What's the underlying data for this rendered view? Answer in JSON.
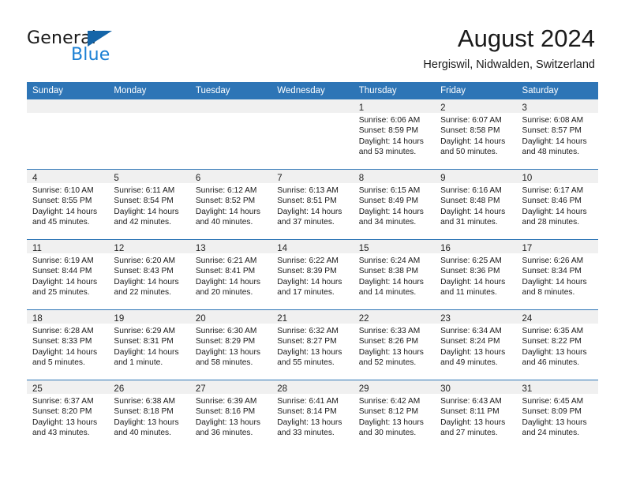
{
  "brand": {
    "name_part1": "General",
    "name_part2": "Blue",
    "triangle_icon": "blue-triangle-icon"
  },
  "header": {
    "title": "August 2024",
    "subtitle": "Hergiswil, Nidwalden, Switzerland"
  },
  "colors": {
    "header_blue": "#2e75b6",
    "daynum_band": "#f0f0f0",
    "logo_blue": "#1a7fd4",
    "logo_triangle": "#1565a8",
    "text": "#1a1a1a"
  },
  "calendar": {
    "weekday_headers": [
      "Sunday",
      "Monday",
      "Tuesday",
      "Wednesday",
      "Thursday",
      "Friday",
      "Saturday"
    ],
    "weeks": [
      [
        {
          "empty": true
        },
        {
          "empty": true
        },
        {
          "empty": true
        },
        {
          "empty": true
        },
        {
          "day": "1",
          "sunrise": "Sunrise: 6:06 AM",
          "sunset": "Sunset: 8:59 PM",
          "daylight1": "Daylight: 14 hours",
          "daylight2": "and 53 minutes."
        },
        {
          "day": "2",
          "sunrise": "Sunrise: 6:07 AM",
          "sunset": "Sunset: 8:58 PM",
          "daylight1": "Daylight: 14 hours",
          "daylight2": "and 50 minutes."
        },
        {
          "day": "3",
          "sunrise": "Sunrise: 6:08 AM",
          "sunset": "Sunset: 8:57 PM",
          "daylight1": "Daylight: 14 hours",
          "daylight2": "and 48 minutes."
        }
      ],
      [
        {
          "day": "4",
          "sunrise": "Sunrise: 6:10 AM",
          "sunset": "Sunset: 8:55 PM",
          "daylight1": "Daylight: 14 hours",
          "daylight2": "and 45 minutes."
        },
        {
          "day": "5",
          "sunrise": "Sunrise: 6:11 AM",
          "sunset": "Sunset: 8:54 PM",
          "daylight1": "Daylight: 14 hours",
          "daylight2": "and 42 minutes."
        },
        {
          "day": "6",
          "sunrise": "Sunrise: 6:12 AM",
          "sunset": "Sunset: 8:52 PM",
          "daylight1": "Daylight: 14 hours",
          "daylight2": "and 40 minutes."
        },
        {
          "day": "7",
          "sunrise": "Sunrise: 6:13 AM",
          "sunset": "Sunset: 8:51 PM",
          "daylight1": "Daylight: 14 hours",
          "daylight2": "and 37 minutes."
        },
        {
          "day": "8",
          "sunrise": "Sunrise: 6:15 AM",
          "sunset": "Sunset: 8:49 PM",
          "daylight1": "Daylight: 14 hours",
          "daylight2": "and 34 minutes."
        },
        {
          "day": "9",
          "sunrise": "Sunrise: 6:16 AM",
          "sunset": "Sunset: 8:48 PM",
          "daylight1": "Daylight: 14 hours",
          "daylight2": "and 31 minutes."
        },
        {
          "day": "10",
          "sunrise": "Sunrise: 6:17 AM",
          "sunset": "Sunset: 8:46 PM",
          "daylight1": "Daylight: 14 hours",
          "daylight2": "and 28 minutes."
        }
      ],
      [
        {
          "day": "11",
          "sunrise": "Sunrise: 6:19 AM",
          "sunset": "Sunset: 8:44 PM",
          "daylight1": "Daylight: 14 hours",
          "daylight2": "and 25 minutes."
        },
        {
          "day": "12",
          "sunrise": "Sunrise: 6:20 AM",
          "sunset": "Sunset: 8:43 PM",
          "daylight1": "Daylight: 14 hours",
          "daylight2": "and 22 minutes."
        },
        {
          "day": "13",
          "sunrise": "Sunrise: 6:21 AM",
          "sunset": "Sunset: 8:41 PM",
          "daylight1": "Daylight: 14 hours",
          "daylight2": "and 20 minutes."
        },
        {
          "day": "14",
          "sunrise": "Sunrise: 6:22 AM",
          "sunset": "Sunset: 8:39 PM",
          "daylight1": "Daylight: 14 hours",
          "daylight2": "and 17 minutes."
        },
        {
          "day": "15",
          "sunrise": "Sunrise: 6:24 AM",
          "sunset": "Sunset: 8:38 PM",
          "daylight1": "Daylight: 14 hours",
          "daylight2": "and 14 minutes."
        },
        {
          "day": "16",
          "sunrise": "Sunrise: 6:25 AM",
          "sunset": "Sunset: 8:36 PM",
          "daylight1": "Daylight: 14 hours",
          "daylight2": "and 11 minutes."
        },
        {
          "day": "17",
          "sunrise": "Sunrise: 6:26 AM",
          "sunset": "Sunset: 8:34 PM",
          "daylight1": "Daylight: 14 hours",
          "daylight2": "and 8 minutes."
        }
      ],
      [
        {
          "day": "18",
          "sunrise": "Sunrise: 6:28 AM",
          "sunset": "Sunset: 8:33 PM",
          "daylight1": "Daylight: 14 hours",
          "daylight2": "and 5 minutes."
        },
        {
          "day": "19",
          "sunrise": "Sunrise: 6:29 AM",
          "sunset": "Sunset: 8:31 PM",
          "daylight1": "Daylight: 14 hours",
          "daylight2": "and 1 minute."
        },
        {
          "day": "20",
          "sunrise": "Sunrise: 6:30 AM",
          "sunset": "Sunset: 8:29 PM",
          "daylight1": "Daylight: 13 hours",
          "daylight2": "and 58 minutes."
        },
        {
          "day": "21",
          "sunrise": "Sunrise: 6:32 AM",
          "sunset": "Sunset: 8:27 PM",
          "daylight1": "Daylight: 13 hours",
          "daylight2": "and 55 minutes."
        },
        {
          "day": "22",
          "sunrise": "Sunrise: 6:33 AM",
          "sunset": "Sunset: 8:26 PM",
          "daylight1": "Daylight: 13 hours",
          "daylight2": "and 52 minutes."
        },
        {
          "day": "23",
          "sunrise": "Sunrise: 6:34 AM",
          "sunset": "Sunset: 8:24 PM",
          "daylight1": "Daylight: 13 hours",
          "daylight2": "and 49 minutes."
        },
        {
          "day": "24",
          "sunrise": "Sunrise: 6:35 AM",
          "sunset": "Sunset: 8:22 PM",
          "daylight1": "Daylight: 13 hours",
          "daylight2": "and 46 minutes."
        }
      ],
      [
        {
          "day": "25",
          "sunrise": "Sunrise: 6:37 AM",
          "sunset": "Sunset: 8:20 PM",
          "daylight1": "Daylight: 13 hours",
          "daylight2": "and 43 minutes."
        },
        {
          "day": "26",
          "sunrise": "Sunrise: 6:38 AM",
          "sunset": "Sunset: 8:18 PM",
          "daylight1": "Daylight: 13 hours",
          "daylight2": "and 40 minutes."
        },
        {
          "day": "27",
          "sunrise": "Sunrise: 6:39 AM",
          "sunset": "Sunset: 8:16 PM",
          "daylight1": "Daylight: 13 hours",
          "daylight2": "and 36 minutes."
        },
        {
          "day": "28",
          "sunrise": "Sunrise: 6:41 AM",
          "sunset": "Sunset: 8:14 PM",
          "daylight1": "Daylight: 13 hours",
          "daylight2": "and 33 minutes."
        },
        {
          "day": "29",
          "sunrise": "Sunrise: 6:42 AM",
          "sunset": "Sunset: 8:12 PM",
          "daylight1": "Daylight: 13 hours",
          "daylight2": "and 30 minutes."
        },
        {
          "day": "30",
          "sunrise": "Sunrise: 6:43 AM",
          "sunset": "Sunset: 8:11 PM",
          "daylight1": "Daylight: 13 hours",
          "daylight2": "and 27 minutes."
        },
        {
          "day": "31",
          "sunrise": "Sunrise: 6:45 AM",
          "sunset": "Sunset: 8:09 PM",
          "daylight1": "Daylight: 13 hours",
          "daylight2": "and 24 minutes."
        }
      ]
    ]
  }
}
